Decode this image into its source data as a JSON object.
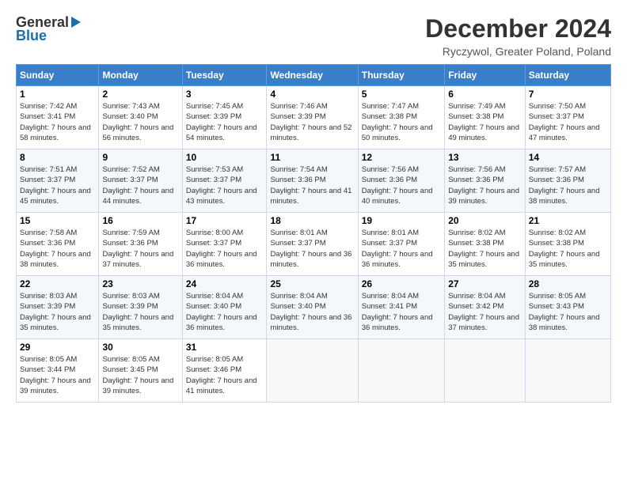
{
  "header": {
    "logo_line1": "General",
    "logo_line2": "Blue",
    "title": "December 2024",
    "subtitle": "Ryczywol, Greater Poland, Poland"
  },
  "days_of_week": [
    "Sunday",
    "Monday",
    "Tuesday",
    "Wednesday",
    "Thursday",
    "Friday",
    "Saturday"
  ],
  "weeks": [
    [
      {
        "day": "1",
        "sunrise": "7:42 AM",
        "sunset": "3:41 PM",
        "daylight": "7 hours and 58 minutes."
      },
      {
        "day": "2",
        "sunrise": "7:43 AM",
        "sunset": "3:40 PM",
        "daylight": "7 hours and 56 minutes."
      },
      {
        "day": "3",
        "sunrise": "7:45 AM",
        "sunset": "3:39 PM",
        "daylight": "7 hours and 54 minutes."
      },
      {
        "day": "4",
        "sunrise": "7:46 AM",
        "sunset": "3:39 PM",
        "daylight": "7 hours and 52 minutes."
      },
      {
        "day": "5",
        "sunrise": "7:47 AM",
        "sunset": "3:38 PM",
        "daylight": "7 hours and 50 minutes."
      },
      {
        "day": "6",
        "sunrise": "7:49 AM",
        "sunset": "3:38 PM",
        "daylight": "7 hours and 49 minutes."
      },
      {
        "day": "7",
        "sunrise": "7:50 AM",
        "sunset": "3:37 PM",
        "daylight": "7 hours and 47 minutes."
      }
    ],
    [
      {
        "day": "8",
        "sunrise": "7:51 AM",
        "sunset": "3:37 PM",
        "daylight": "7 hours and 45 minutes."
      },
      {
        "day": "9",
        "sunrise": "7:52 AM",
        "sunset": "3:37 PM",
        "daylight": "7 hours and 44 minutes."
      },
      {
        "day": "10",
        "sunrise": "7:53 AM",
        "sunset": "3:37 PM",
        "daylight": "7 hours and 43 minutes."
      },
      {
        "day": "11",
        "sunrise": "7:54 AM",
        "sunset": "3:36 PM",
        "daylight": "7 hours and 41 minutes."
      },
      {
        "day": "12",
        "sunrise": "7:56 AM",
        "sunset": "3:36 PM",
        "daylight": "7 hours and 40 minutes."
      },
      {
        "day": "13",
        "sunrise": "7:56 AM",
        "sunset": "3:36 PM",
        "daylight": "7 hours and 39 minutes."
      },
      {
        "day": "14",
        "sunrise": "7:57 AM",
        "sunset": "3:36 PM",
        "daylight": "7 hours and 38 minutes."
      }
    ],
    [
      {
        "day": "15",
        "sunrise": "7:58 AM",
        "sunset": "3:36 PM",
        "daylight": "7 hours and 38 minutes."
      },
      {
        "day": "16",
        "sunrise": "7:59 AM",
        "sunset": "3:36 PM",
        "daylight": "7 hours and 37 minutes."
      },
      {
        "day": "17",
        "sunrise": "8:00 AM",
        "sunset": "3:37 PM",
        "daylight": "7 hours and 36 minutes."
      },
      {
        "day": "18",
        "sunrise": "8:01 AM",
        "sunset": "3:37 PM",
        "daylight": "7 hours and 36 minutes."
      },
      {
        "day": "19",
        "sunrise": "8:01 AM",
        "sunset": "3:37 PM",
        "daylight": "7 hours and 36 minutes."
      },
      {
        "day": "20",
        "sunrise": "8:02 AM",
        "sunset": "3:38 PM",
        "daylight": "7 hours and 35 minutes."
      },
      {
        "day": "21",
        "sunrise": "8:02 AM",
        "sunset": "3:38 PM",
        "daylight": "7 hours and 35 minutes."
      }
    ],
    [
      {
        "day": "22",
        "sunrise": "8:03 AM",
        "sunset": "3:39 PM",
        "daylight": "7 hours and 35 minutes."
      },
      {
        "day": "23",
        "sunrise": "8:03 AM",
        "sunset": "3:39 PM",
        "daylight": "7 hours and 35 minutes."
      },
      {
        "day": "24",
        "sunrise": "8:04 AM",
        "sunset": "3:40 PM",
        "daylight": "7 hours and 36 minutes."
      },
      {
        "day": "25",
        "sunrise": "8:04 AM",
        "sunset": "3:40 PM",
        "daylight": "7 hours and 36 minutes."
      },
      {
        "day": "26",
        "sunrise": "8:04 AM",
        "sunset": "3:41 PM",
        "daylight": "7 hours and 36 minutes."
      },
      {
        "day": "27",
        "sunrise": "8:04 AM",
        "sunset": "3:42 PM",
        "daylight": "7 hours and 37 minutes."
      },
      {
        "day": "28",
        "sunrise": "8:05 AM",
        "sunset": "3:43 PM",
        "daylight": "7 hours and 38 minutes."
      }
    ],
    [
      {
        "day": "29",
        "sunrise": "8:05 AM",
        "sunset": "3:44 PM",
        "daylight": "7 hours and 39 minutes."
      },
      {
        "day": "30",
        "sunrise": "8:05 AM",
        "sunset": "3:45 PM",
        "daylight": "7 hours and 39 minutes."
      },
      {
        "day": "31",
        "sunrise": "8:05 AM",
        "sunset": "3:46 PM",
        "daylight": "7 hours and 41 minutes."
      },
      null,
      null,
      null,
      null
    ]
  ]
}
